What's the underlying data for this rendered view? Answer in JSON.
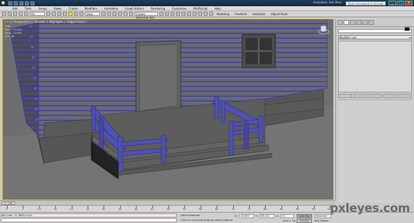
{
  "titlebar": {
    "app_title": "Autodesk 3ds Max",
    "search_placeholder": "Type a keyword or phrase",
    "minimize": "_",
    "maximize": "□",
    "close": "x"
  },
  "menu": [
    "Edit",
    "Tools",
    "Group",
    "Views",
    "Create",
    "Modifiers",
    "Animation",
    "Graph Editors",
    "Rendering",
    "Customize",
    "MAXScript",
    "Help"
  ],
  "toolbar": {
    "selection_filter": "All",
    "ref_coord": "View",
    "named_sets": "Create Selection Set",
    "ribbon_labels": [
      "Modeling",
      "Freeform",
      "Selection",
      "Object Paint"
    ]
  },
  "viewport": {
    "label": "[ + ] [ Perspective ] [ Smooth + Highlights + Edged Faces ]",
    "stats": [
      "Total",
      "Polys: 15,634",
      "Verts: 15,960",
      "FPS: 38"
    ]
  },
  "panel": {
    "modifier_list": "Modifier List"
  },
  "timeline": {
    "frame": "0 / 100",
    "ticks": [
      "0",
      "5",
      "10",
      "15",
      "20",
      "25",
      "30",
      "35",
      "40",
      "45",
      "50",
      "55",
      "60",
      "65",
      "70",
      "75",
      "80",
      "85",
      "90",
      "95",
      "100"
    ]
  },
  "status": {
    "maxscript_line": "Welcome to MAXScript.",
    "selection": "None Selected",
    "prompt": "Click or click-and-drag to select objects",
    "x_label": "X:",
    "x_value": "-45.897",
    "y_label": "Y:",
    "y_value": "58.421",
    "z_label": "Z:",
    "z_value": "0.0",
    "grid": "Grid = 10.0",
    "autokey": "Auto Key",
    "setkey": "Set Key",
    "selected": "Selected",
    "key_filters": "Key Filters..."
  },
  "watermark": "pxleyes.com",
  "colors": {
    "log_wire": "#3f3fa8",
    "log_face": "#5c5c6e",
    "viewport_bg": "#6f6f6f",
    "active_border": "#d6c640"
  }
}
